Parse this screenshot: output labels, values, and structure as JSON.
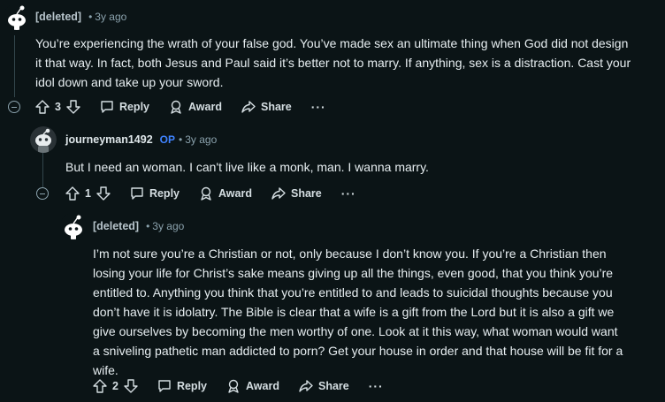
{
  "comments": [
    {
      "author": "[deleted]",
      "age": "3y ago",
      "body": "You’re experiencing the wrath of your false god. You’ve made sex an ultimate thing when God did not design it that way. In fact, both Jesus and Paul said it’s better not to marry. If anything, sex is a distraction. Cast your idol down and take up your sword.",
      "votes": "3"
    },
    {
      "author": "journeyman1492",
      "flair": "OP",
      "age": "3y ago",
      "body": "But I need an woman. I can't live like a monk, man. I wanna marry.",
      "votes": "1"
    },
    {
      "author": "[deleted]",
      "age": "3y ago",
      "body": "I’m not sure you’re a Christian or not, only because I don’t know you. If you’re a Christian then losing your life for Christ’s sake means giving up all the things, even good, that you think you’re entitled to. Anything you think that you’re entitled to and leads to suicidal thoughts because you don’t have it is idolatry. The Bible is clear that a wife is a gift from the Lord but it is also a gift we give ourselves by becoming the men worthy of one. Look at it this way, what woman would want a sniveling pathetic man addicted to porn? Get your house in order and that house will be fit for a wife.",
      "votes": "2"
    }
  ],
  "actions": {
    "reply": "Reply",
    "award": "Award",
    "share": "Share",
    "more": "···",
    "separator": "•"
  },
  "icons": [
    "snoo-avatar-icon",
    "upvote-icon",
    "downvote-icon",
    "reply-icon",
    "award-icon",
    "share-icon",
    "more-icon",
    "collapse-icon"
  ]
}
